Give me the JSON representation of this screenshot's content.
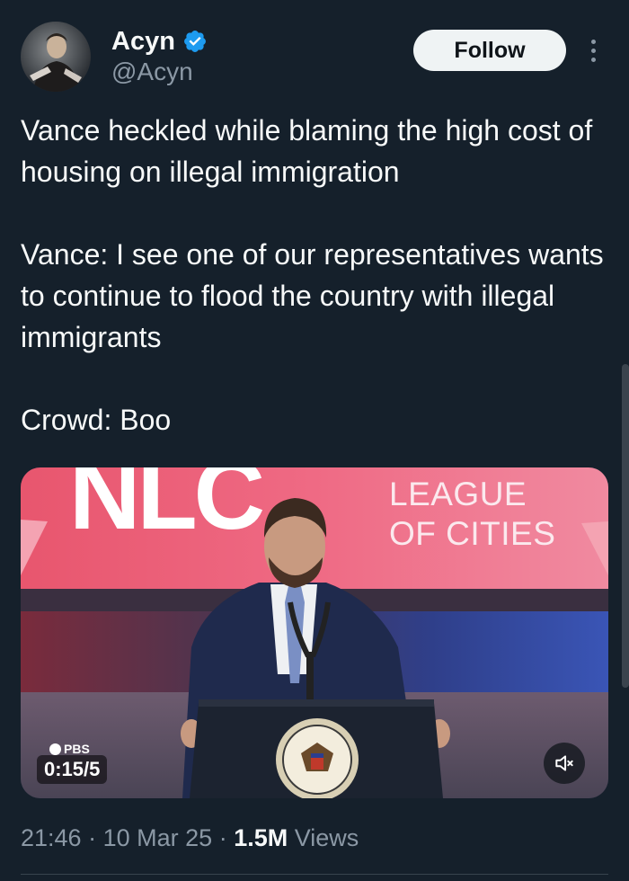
{
  "author": {
    "display_name": "Acyn",
    "handle": "@Acyn",
    "verified": true,
    "avatar_icon": "avatar-photo"
  },
  "actions": {
    "follow_label": "Follow",
    "more_icon": "more-vertical-icon"
  },
  "tweet": {
    "text": "Vance heckled while blaming the high cost of housing on illegal immigration\n\nVance: I see one of our representatives wants to continue to flood the country with illegal immigrants\n\nCrowd: Boo"
  },
  "media": {
    "banner_left": "NLC",
    "banner_right_line1": "LEAGUE",
    "banner_right_line2": "OF CITIES",
    "network_badge": "PBS",
    "timestamp": "0:15/5",
    "mute_icon": "volume-muted-icon",
    "podium_seal_text": "PRESIDENT OF THE UNITED STATES"
  },
  "meta": {
    "time": "21:46",
    "date": "10 Mar 25",
    "separator": "·",
    "views_count": "1.5M",
    "views_label": "Views"
  },
  "colors": {
    "background": "#15202b",
    "text": "#f7f9f9",
    "secondary_text": "#8b98a5",
    "verified_blue": "#1d9bf0",
    "follow_bg": "#eff3f4"
  }
}
